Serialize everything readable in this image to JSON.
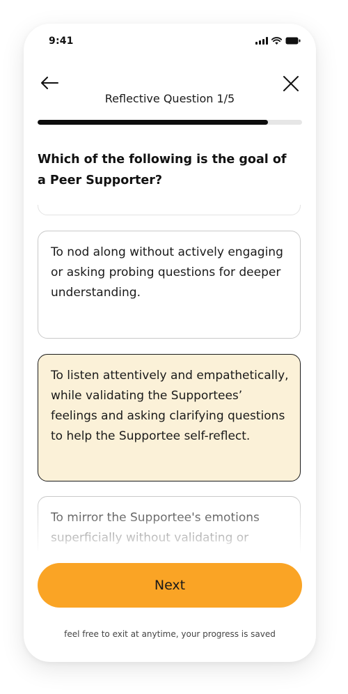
{
  "status_bar": {
    "time": "9:41"
  },
  "header": {
    "question_counter": "Reflective Question 1/5"
  },
  "progress": {
    "fraction": 0.87
  },
  "question": {
    "text": "Which of the following is the goal of a Peer Supporter?"
  },
  "options": [
    {
      "text": ""
    },
    {
      "text": "To nod along without actively engaging or asking probing questions for deeper understanding."
    },
    {
      "text": "To listen attentively and empathetically, while validating the Supportees’ feelings and asking clarifying questions to help the Supportee self-reflect."
    },
    {
      "text": "To mirror the Supportee's emotions superficially without validating or"
    }
  ],
  "selected_option_index": 2,
  "next_button": {
    "label": "Next"
  },
  "footer": {
    "note": "feel free to exit at anytime, your progress is saved"
  },
  "colors": {
    "accent": "#faa425",
    "selected_bg": "#fbf1d8",
    "progress": "#0d0d0d",
    "track": "#e6e6e6"
  }
}
